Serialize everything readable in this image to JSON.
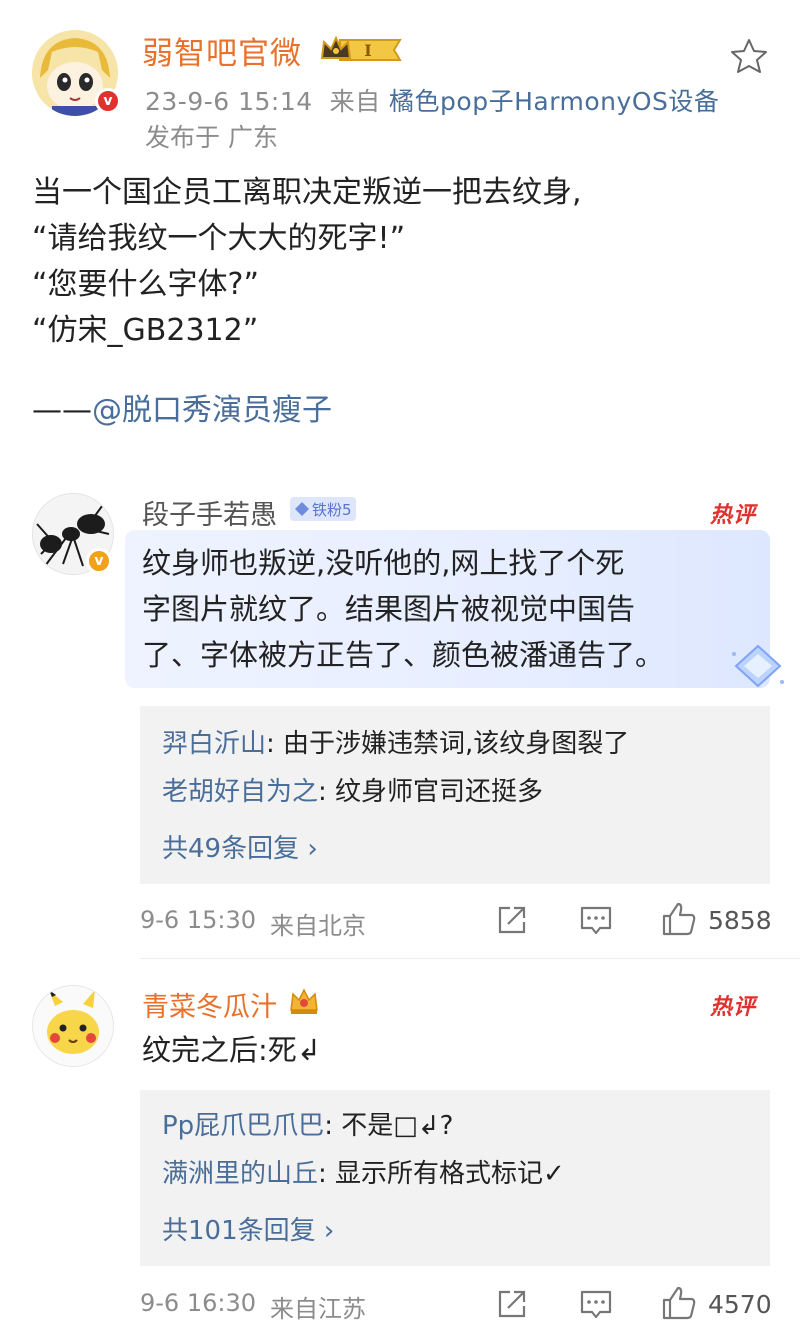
{
  "post": {
    "author": "弱智吧官微",
    "level_badge": "I",
    "time": "23-9-6 15:14",
    "source_prefix": "来自",
    "source": "橘色pop子HarmonyOS设备",
    "location": "发布于 广东",
    "lines": [
      "当一个国企员工离职决定叛逆一把去纹身,",
      "“请给我纹一个大大的死字!”",
      "“您要什么字体?”",
      "“仿宋_GB2312”"
    ],
    "credit_dash": "——",
    "credit_mention": "@脱口秀演员瘦子"
  },
  "comments": [
    {
      "name": "段子手若愚",
      "fan_badge": "铁粉5",
      "hot_label": "热评",
      "text_lines": [
        "纹身师也叛逆,没听他的,网上找了个死",
        "字图片就纹了。结果图片被视觉中国告",
        "了、字体被方正告了、颜色被潘通告了。"
      ],
      "replies": [
        {
          "name": "羿白沂山",
          "text": ": 由于涉嫌违禁词,该纹身图裂了"
        },
        {
          "name": "老胡好自为之",
          "text": ": 纹身师官司还挺多"
        }
      ],
      "more": "共49条回复 ›",
      "time": "9-6 15:30",
      "from": "来自北京",
      "likes": "5858"
    },
    {
      "name": "青菜冬瓜汁",
      "hot_label": "热评",
      "text_lines": [
        "纹完之后:死↲"
      ],
      "replies": [
        {
          "name": "Pp屁爪巴爪巴",
          "text": ": 不是□↲?"
        },
        {
          "name": "满洲里的山丘",
          "text": ": 显示所有格式标记✓"
        }
      ],
      "more": "共101条回复 ›",
      "time": "9-6 16:30",
      "from": "来自江苏",
      "likes": "4570"
    }
  ],
  "icons": {
    "favorite": "star-outline-icon",
    "share": "share-icon",
    "comment": "comment-icon",
    "like": "thumbs-up-icon"
  },
  "colors": {
    "author_orange": "#e8722c",
    "link_blue": "#4a6e9a",
    "hot_red": "#e0312d",
    "meta_gray": "#8c8c8c"
  }
}
